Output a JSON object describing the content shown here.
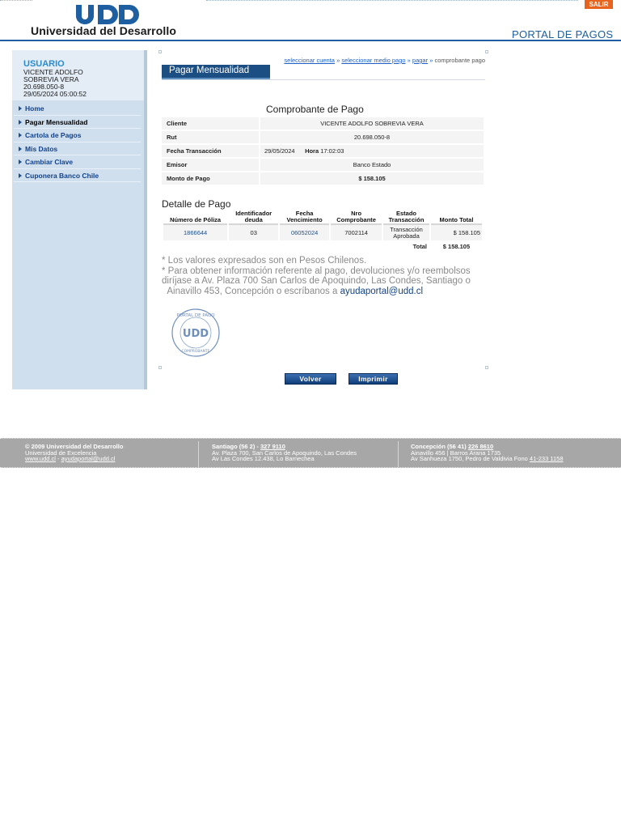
{
  "header": {
    "logo_mark": "UDD",
    "logo_text": "Universidad del Desarrollo",
    "logout_label": "SALIR",
    "portal_title": "PORTAL DE PAGOS",
    "brand_color": "#1d5fa0",
    "logout_color": "#e8641e"
  },
  "sidebar": {
    "user_label": "USUARIO",
    "user_name_1": "VICENTE ADOLFO",
    "user_name_2": "SOBREVIA VERA",
    "user_rut": "20.698.050-8",
    "user_datetime": "29/05/2024 05:00:52",
    "items": [
      {
        "label": "Home",
        "icon": "arrow-right-icon"
      },
      {
        "label": "Pagar Mensualidad",
        "icon": "arrow-right-icon"
      },
      {
        "label": "Cartola de Pagos",
        "icon": "arrow-right-icon"
      },
      {
        "label": "Mis Datos",
        "icon": "arrow-right-icon"
      },
      {
        "label": "Cambiar Clave",
        "icon": "arrow-right-icon"
      },
      {
        "label": "Cuponera Banco Chile",
        "icon": "arrow-right-icon"
      }
    ]
  },
  "breadcrumb": {
    "step1": "seleccionar cuenta",
    "step2": "seleccionar medio pago",
    "step3": "pagar",
    "current": "comprobante pago",
    "separator": "»"
  },
  "main": {
    "tab_title": "Pagar Mensualidad",
    "receipt_title": "Comprobante de Pago",
    "receipt": {
      "cliente_label": "Cliente",
      "cliente_value": "VICENTE ADOLFO SOBREVIA VERA",
      "rut_label": "Rut",
      "rut_value": "20.698.050-8",
      "fecha_label": "Fecha Transacción",
      "fecha_value": "29/05/2024",
      "hora_label": "Hora",
      "hora_value": "17:02:03",
      "emisor_label": "Emisor",
      "emisor_value": "Banco Estado",
      "monto_label": "Monto de Pago",
      "monto_value": "$ 158.105"
    },
    "detail_title": "Detalle de Pago",
    "detail_headers": {
      "poliza": "Número de Póliza",
      "ident_1": "Identificador",
      "ident_2": "deuda",
      "fecha_1": "Fecha",
      "fecha_2": "Vencimiento",
      "nro_1": "Nro",
      "nro_2": "Comprobante",
      "estado_1": "Estado",
      "estado_2": "Transacción",
      "monto": "Monto Total"
    },
    "detail_row": {
      "poliza": "1866644",
      "ident": "03",
      "fecha": "06052024",
      "nro": "7002114",
      "estado_1": "Transacción",
      "estado_2": "Aprobada",
      "monto": "$ 158.105"
    },
    "total_label": "Total",
    "total_value": "$ 158.105",
    "note_1": "* Los valores expresados son en Pesos Chilenos.",
    "note_2": "* Para obtener información referente al pago, devoluciones y/o reembolsos diríjase a Av. Plaza 700 San Carlos de Apoquindo, Las Condes, Santiago o",
    "note_3": "Ainavillo 453, Concepción o escríbanos a",
    "note_email": "ayudaportal@udd.cl",
    "stamp_top": "PORTAL DE PAGO",
    "stamp_center": "UDD",
    "stamp_bottom": "COMPROBANTE"
  },
  "buttons": {
    "back": "Volver",
    "print": "Imprimir"
  },
  "footer": {
    "col1_line1": "© 2009 Universidad del Desarrollo",
    "col1_line2": "Universidad de Excelencia",
    "col1_web": "www.udd.cl",
    "col1_dash": " - ",
    "col1_mail": "ayudaportal@udd.cl",
    "col2_line1_prefix": "Santiago (56 2) - ",
    "col2_phone": "327 9110",
    "col2_line2": "Av. Plaza 700, San Carlos de Apoquindo, Las Condes",
    "col2_line3": "Av Las Condes 12.438, Lo Barnechea",
    "col3_line1_prefix": "Concepción (56 41) ",
    "col3_phone": "226 8610",
    "col3_line2": "Ainavillo 456 | Barros Arana 1735",
    "col3_line3_prefix": "Av Sanhueza 1750, Pedro de Valdivia Fono ",
    "col3_phone2": "41-233 1158"
  }
}
